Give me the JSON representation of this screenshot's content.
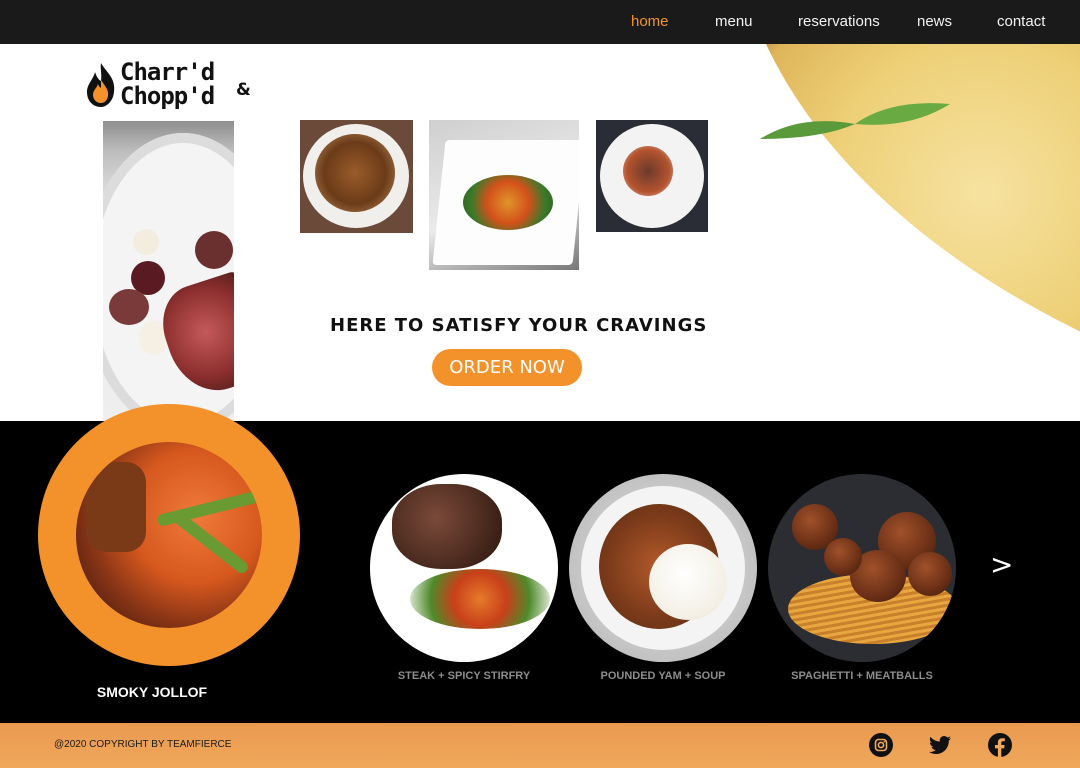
{
  "nav": {
    "items": [
      {
        "label": "home",
        "active": true
      },
      {
        "label": "menu"
      },
      {
        "label": "reservations"
      },
      {
        "label": "news"
      },
      {
        "label": "contact"
      }
    ]
  },
  "brand": {
    "line1": "Charr'd",
    "line2": "Chopp'd",
    "amp": "&"
  },
  "hero": {
    "tagline": "HERE TO SATISFY YOUR CRAVINGS",
    "cta_label": "ORDER NOW"
  },
  "featured": {
    "label": "SMOKY JOLLOF"
  },
  "dishes": [
    {
      "label": "STEAK + SPICY STIRFRY"
    },
    {
      "label": "POUNDED YAM + SOUP"
    },
    {
      "label": "SPAGHETTI + MEATBALLS"
    }
  ],
  "carousel": {
    "next_glyph": ">"
  },
  "footer": {
    "copyright": "@2020 COPYRIGHT BY TEAMFIERCE"
  },
  "social": [
    "instagram-icon",
    "twitter-icon",
    "facebook-icon"
  ],
  "colors": {
    "accent": "#f3922b",
    "nav_bg": "#1a1a1a",
    "strip_bg": "#000000",
    "footer_bg": "#f0a85b"
  }
}
